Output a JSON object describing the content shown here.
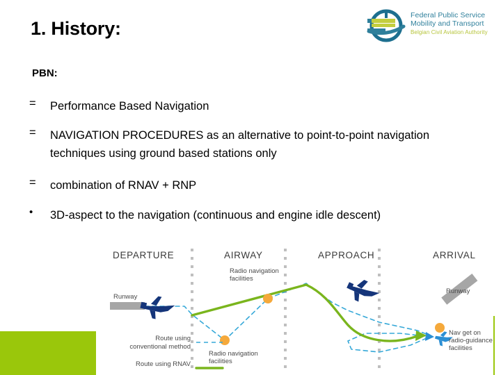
{
  "slide": {
    "title": "1. History:",
    "section_label": "PBN:"
  },
  "logo": {
    "line1": "Federal Public Service",
    "line2": "Mobility and Transport",
    "line3": "Belgian Civil Aviation Authority",
    "mark_name": "belgian-federal-service-emblem",
    "colors": {
      "teal": "#2e7f9b",
      "olive": "#b6c43a"
    }
  },
  "bullets": [
    {
      "marker": "=",
      "text": "Performance Based Navigation"
    },
    {
      "marker": "=",
      "text": "NAVIGATION PROCEDURES as an alternative to point-to-point navigation techniques using ground based stations only"
    },
    {
      "marker": "=",
      "text": "combination of RNAV + RNP"
    },
    {
      "marker": "•",
      "text": "3D-aspect to the navigation (continuous and engine idle descent)"
    }
  ],
  "diagram": {
    "segments": [
      {
        "label": "DEPARTURE"
      },
      {
        "label": "AIRWAY"
      },
      {
        "label": "APPROACH"
      },
      {
        "label": "ARRIVAL"
      }
    ],
    "labels": {
      "runway_departure": "Runway",
      "radio_nav_upper": "Radio navigation facilities",
      "radio_nav_upper_line1": "Radio navigation",
      "radio_nav_upper_line2": "facilities",
      "radio_nav_lower_line1": "Radio navigation",
      "radio_nav_lower_line2": "facilities",
      "runway_arrival": "Runway",
      "nav_guidance_line1": "Nav get on",
      "nav_guidance_line2": "radio-guidance",
      "nav_guidance_line3": "facilities"
    },
    "legend": {
      "conventional_line1": "Route using",
      "conventional_line2": "conventional method",
      "rnav": "Route using RNAV"
    },
    "colors": {
      "conventional_route": "#35a8d8",
      "rnav_route": "#7ab51d",
      "waypoint": "#f5a93b",
      "aircraft": "#15357a",
      "aircraft_small": "#2b8fd4",
      "runway": "#a6a6a6",
      "divider_dot": "#bfbfbf",
      "header_text": "#3a3a3a"
    }
  },
  "decor": {
    "green_block_color": "#9ac70b",
    "green_rule_color": "#9ac70b"
  }
}
